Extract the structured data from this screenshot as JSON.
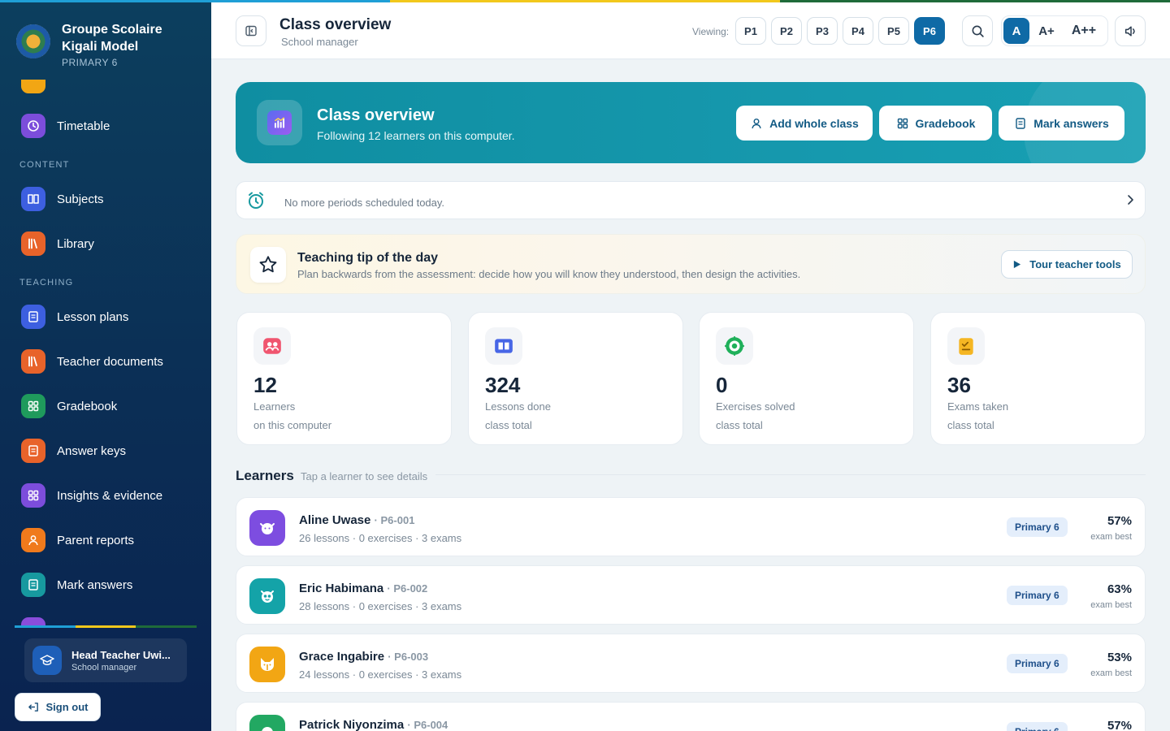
{
  "colors": {
    "strip": [
      "#1f9fd6",
      "#f2c81c",
      "#1f6b3a"
    ],
    "accent": "#0f6aa6",
    "banner": "#1698ad"
  },
  "school": {
    "name": "Groupe Scolaire Kigali Model",
    "level": "PRIMARY 6"
  },
  "sidebar": {
    "items": [
      {
        "label": "Timetable",
        "icon": "clock-icon",
        "color": "#7c4ddb"
      },
      {
        "label": "Subjects",
        "icon": "book-open-icon",
        "color": "#3d5fe0"
      },
      {
        "label": "Library",
        "icon": "books-icon",
        "color": "#e8632a"
      },
      {
        "label": "Lesson plans",
        "icon": "document-icon",
        "color": "#3d5fe0"
      },
      {
        "label": "Teacher documents",
        "icon": "books-icon",
        "color": "#e8632a"
      },
      {
        "label": "Gradebook",
        "icon": "grid-icon",
        "color": "#1f9a5c"
      },
      {
        "label": "Answer keys",
        "icon": "document-icon",
        "color": "#e8632a"
      },
      {
        "label": "Insights & evidence",
        "icon": "grid-icon",
        "color": "#7c4ddb"
      },
      {
        "label": "Parent reports",
        "icon": "user-icon",
        "color": "#f07a1c"
      },
      {
        "label": "Mark answers",
        "icon": "document-icon",
        "color": "#17999f"
      }
    ],
    "section_content": "CONTENT",
    "section_teaching": "TEACHING"
  },
  "user": {
    "name": "Head Teacher Uwi...",
    "role": "School manager",
    "signout": "Sign out"
  },
  "header": {
    "title": "Class overview",
    "subtitle": "School manager",
    "viewing_label": "Viewing:",
    "grades": [
      "P1",
      "P2",
      "P3",
      "P4",
      "P5",
      "P6"
    ],
    "active_grade": "P6",
    "font_sizes": [
      "A",
      "A+",
      "A++"
    ]
  },
  "banner": {
    "title": "Class overview",
    "subtitle": "Following 12 learners on this computer.",
    "buttons": [
      "Add whole class",
      "Gradebook",
      "Mark answers"
    ]
  },
  "schedule": {
    "text": "No more periods scheduled today."
  },
  "tip": {
    "title": "Teaching tip of the day",
    "text": "Plan backwards from the assessment: decide how you will know they understood, then design the activities.",
    "button": "Tour teacher tools"
  },
  "stats": [
    {
      "value": "12",
      "label": "Learners",
      "sub": "on this computer",
      "icon": "users-icon"
    },
    {
      "value": "324",
      "label": "Lessons done",
      "sub": "class total",
      "icon": "book-icon"
    },
    {
      "value": "0",
      "label": "Exercises solved",
      "sub": "class total",
      "icon": "target-icon"
    },
    {
      "value": "36",
      "label": "Exams taken",
      "sub": "class total",
      "icon": "clipboard-icon"
    }
  ],
  "learners": {
    "title": "Learners",
    "hint": "Tap a learner to see details",
    "rows": [
      {
        "name": "Aline Uwase",
        "code": "P6-001",
        "meta": "26 lessons · 0 exercises · 3 exams",
        "badge": "Primary 6",
        "score": "57%",
        "score_label": "exam best",
        "avatar_color": "#7d4de0",
        "avatar_icon": "cat-icon"
      },
      {
        "name": "Eric Habimana",
        "code": "P6-002",
        "meta": "28 lessons · 0 exercises · 3 exams",
        "badge": "Primary 6",
        "score": "63%",
        "score_label": "exam best",
        "avatar_color": "#14a3a8",
        "avatar_icon": "owl-icon"
      },
      {
        "name": "Grace Ingabire",
        "code": "P6-003",
        "meta": "24 lessons · 0 exercises · 3 exams",
        "badge": "Primary 6",
        "score": "53%",
        "score_label": "exam best",
        "avatar_color": "#f2a614",
        "avatar_icon": "fox-icon"
      },
      {
        "name": "Patrick Niyonzima",
        "code": "P6-004",
        "meta": "",
        "badge": "Primary 6",
        "score": "57%",
        "score_label": "",
        "avatar_color": "#22a862",
        "avatar_icon": "face-icon"
      }
    ]
  }
}
